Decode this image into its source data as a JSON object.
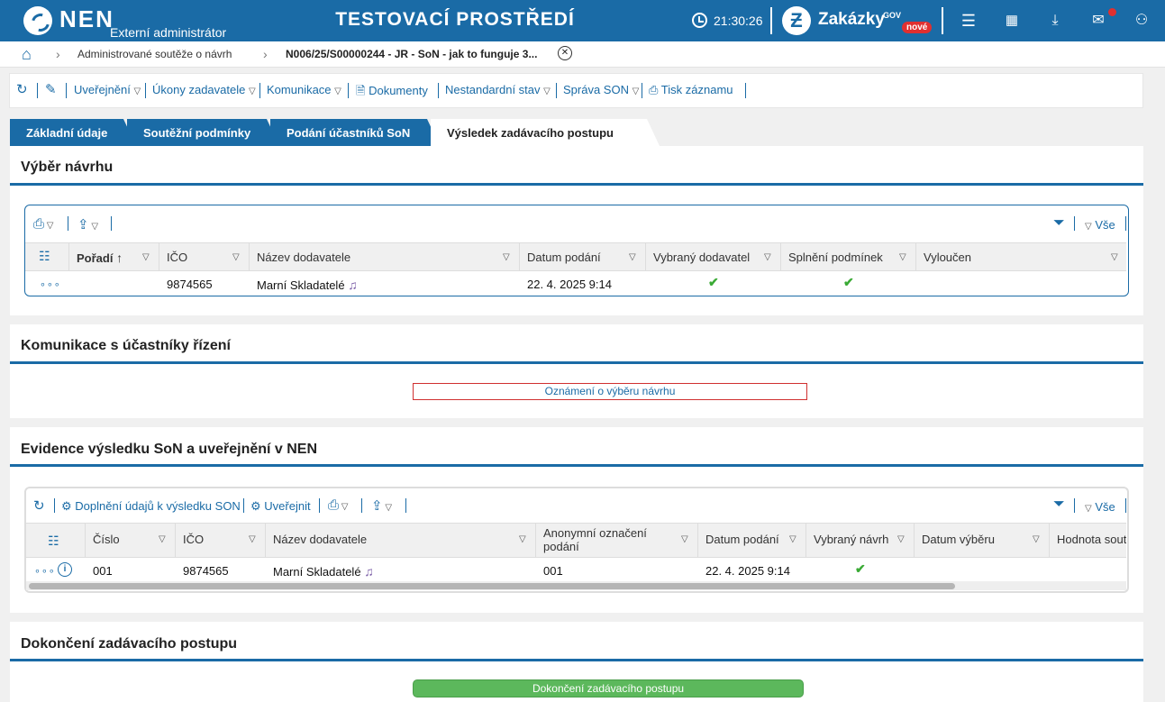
{
  "header": {
    "logo": "NEN",
    "role": "Externí administrátor",
    "environment": "TESTOVACÍ PROSTŘEDÍ",
    "time": "21:30:26",
    "zakazky_label": "Zakázky",
    "zakazky_sup": "GOV",
    "zakazky_badge": "nové"
  },
  "breadcrumb": {
    "item1": "Administrované soutěže o návrh",
    "item2": "N006/25/S00000244 - JR - SoN - jak to funguje 3..."
  },
  "toolbar": {
    "items": [
      "Uveřejnění",
      "Úkony zadavatele",
      "Komunikace",
      "Dokumenty",
      "Nestandardní stav",
      "Správa SON",
      "Tisk záznamu"
    ]
  },
  "tabs": [
    "Základní údaje",
    "Soutěžní podmínky",
    "Podání účastníků SoN",
    "Výsledek zadávacího postupu"
  ],
  "section1": {
    "title": "Výběr návrhu",
    "filter_all": "Vše",
    "columns": [
      "Pořadí",
      "IČO",
      "Název dodavatele",
      "Datum podání",
      "Vybraný dodavatel",
      "Splnění podmínek",
      "Vyloučen"
    ],
    "row": {
      "ico": "9874565",
      "name": "Marní Skladatelé",
      "date": "22. 4. 2025 9:14",
      "selected": "✔",
      "fulfilled": "✔"
    }
  },
  "section2": {
    "title": "Komunikace s účastníky řízení",
    "button": "Oznámení o výběru návrhu"
  },
  "section3": {
    "title": "Evidence výsledku SoN a uveřejnění v NEN",
    "btn_supplement": "Doplnění údajů k výsledku SON",
    "btn_publish": "Uveřejnit",
    "filter_all": "Vše",
    "columns": [
      "Číslo",
      "IČO",
      "Název dodavatele",
      "Anonymní označení",
      "podání",
      "Datum podání",
      "Vybraný návrh",
      "Datum výběru",
      "Hodnota soutě"
    ],
    "row": {
      "number": "001",
      "ico": "9874565",
      "name": "Marní Skladatelé",
      "anon": "001",
      "date": "22. 4. 2025 9:14",
      "selected": "✔"
    }
  },
  "section4": {
    "title": "Dokončení zadávacího postupu",
    "button": "Dokončení zadávacího postupu"
  },
  "colors": {
    "primary": "#1a6ba6",
    "success": "#5cb85c",
    "danger": "#e03030"
  }
}
